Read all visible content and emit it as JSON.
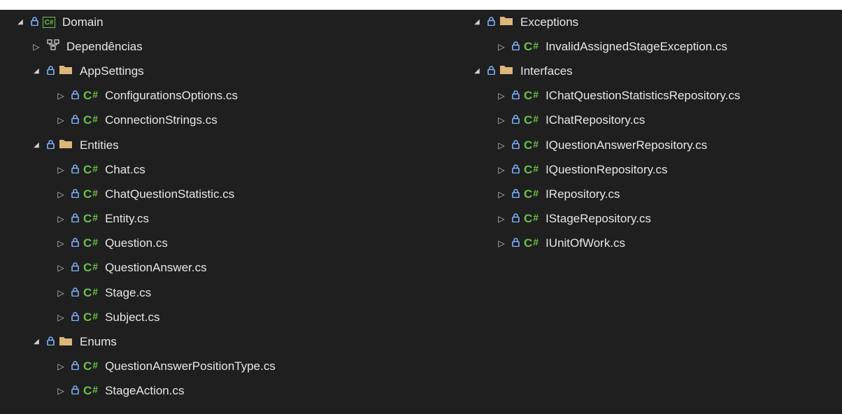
{
  "tree_left": [
    {
      "kind": "project",
      "expanded": true,
      "locked": true,
      "label": "Domain",
      "indent": 0
    },
    {
      "kind": "deps",
      "expanded": false,
      "locked": false,
      "label": "Dependências",
      "indent": 1
    },
    {
      "kind": "folder",
      "expanded": true,
      "locked": true,
      "label": "AppSettings",
      "indent": 1
    },
    {
      "kind": "file",
      "expanded": false,
      "locked": true,
      "label": "ConfigurationsOptions.cs",
      "indent": 2
    },
    {
      "kind": "file",
      "expanded": false,
      "locked": true,
      "label": "ConnectionStrings.cs",
      "indent": 2
    },
    {
      "kind": "folder",
      "expanded": true,
      "locked": true,
      "label": "Entities",
      "indent": 1
    },
    {
      "kind": "file",
      "expanded": false,
      "locked": true,
      "label": "Chat.cs",
      "indent": 2
    },
    {
      "kind": "file",
      "expanded": false,
      "locked": true,
      "label": "ChatQuestionStatistic.cs",
      "indent": 2
    },
    {
      "kind": "file",
      "expanded": false,
      "locked": true,
      "label": "Entity.cs",
      "indent": 2
    },
    {
      "kind": "file",
      "expanded": false,
      "locked": true,
      "label": "Question.cs",
      "indent": 2
    },
    {
      "kind": "file",
      "expanded": false,
      "locked": true,
      "label": "QuestionAnswer.cs",
      "indent": 2
    },
    {
      "kind": "file",
      "expanded": false,
      "locked": true,
      "label": "Stage.cs",
      "indent": 2
    },
    {
      "kind": "file",
      "expanded": false,
      "locked": true,
      "label": "Subject.cs",
      "indent": 2
    },
    {
      "kind": "folder",
      "expanded": true,
      "locked": true,
      "label": "Enums",
      "indent": 1
    },
    {
      "kind": "file",
      "expanded": false,
      "locked": true,
      "label": "QuestionAnswerPositionType.cs",
      "indent": 2
    },
    {
      "kind": "file",
      "expanded": false,
      "locked": true,
      "label": "StageAction.cs",
      "indent": 2
    }
  ],
  "tree_right": [
    {
      "kind": "folder",
      "expanded": true,
      "locked": true,
      "label": "Exceptions",
      "indent": 1
    },
    {
      "kind": "file",
      "expanded": false,
      "locked": true,
      "label": "InvalidAssignedStageException.cs",
      "indent": 2
    },
    {
      "kind": "folder",
      "expanded": true,
      "locked": true,
      "label": "Interfaces",
      "indent": 1
    },
    {
      "kind": "file",
      "expanded": false,
      "locked": true,
      "label": "IChatQuestionStatisticsRepository.cs",
      "indent": 2
    },
    {
      "kind": "file",
      "expanded": false,
      "locked": true,
      "label": "IChatRepository.cs",
      "indent": 2
    },
    {
      "kind": "file",
      "expanded": false,
      "locked": true,
      "label": "IQuestionAnswerRepository.cs",
      "indent": 2
    },
    {
      "kind": "file",
      "expanded": false,
      "locked": true,
      "label": "IQuestionRepository.cs",
      "indent": 2
    },
    {
      "kind": "file",
      "expanded": false,
      "locked": true,
      "label": "IRepository.cs",
      "indent": 2
    },
    {
      "kind": "file",
      "expanded": false,
      "locked": true,
      "label": "IStageRepository.cs",
      "indent": 2
    },
    {
      "kind": "file",
      "expanded": false,
      "locked": true,
      "label": "IUnitOfWork.cs",
      "indent": 2
    }
  ],
  "icons": {
    "expanded": "triangle-down-icon",
    "collapsed": "triangle-right-icon",
    "lock": "lock-icon",
    "folder": "folder-icon",
    "csharp": "csharp-file-icon",
    "project": "csharp-project-icon",
    "dependencies": "dependencies-icon"
  },
  "csharp_badge": {
    "letter": "C",
    "hash": "#"
  },
  "project_badge": "C#",
  "colors": {
    "background": "#1f1f1f",
    "text": "#e6e6e6",
    "csharp": "#6cc04a",
    "lock": "#7fb2ff",
    "folder": "#dcb67a"
  }
}
